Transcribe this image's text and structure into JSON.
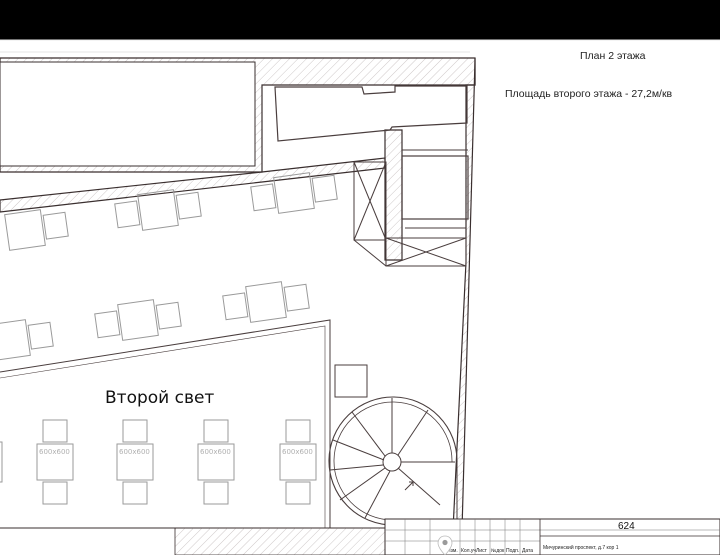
{
  "drawing": {
    "title": "План 2 этажа",
    "area_note": "Площадь второго этажа - 27,2м/кв",
    "zone_label": "Второй свет",
    "table_size_label": "600х600"
  },
  "stamp": {
    "sheet_number": "624",
    "address": "Мичуринский проспект, д.7 кор 1",
    "col_1": "Изм.",
    "col_2": "Кол.уч",
    "col_3": "Лист",
    "col_4": "№док",
    "col_5": "Подп.",
    "col_6": "Дата"
  },
  "icons": {
    "pin": "map-pin-icon"
  },
  "colors": {
    "background": "#000000",
    "paper": "#ffffff",
    "ink": "#3a2f2f"
  }
}
